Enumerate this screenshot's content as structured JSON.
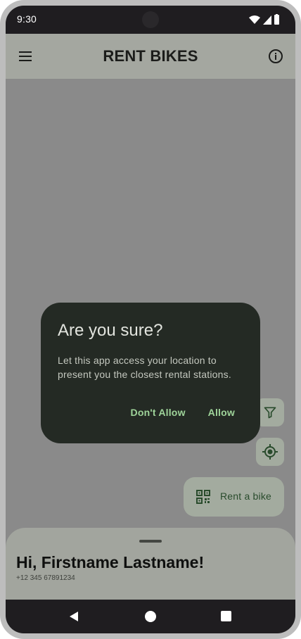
{
  "status_bar": {
    "time": "9:30",
    "icons": [
      "wifi-icon",
      "cellular-signal-icon",
      "battery-icon"
    ]
  },
  "app_bar": {
    "title": "RENT BIKES",
    "left_icon": "menu-icon",
    "right_icon": "info-icon"
  },
  "dialog": {
    "title": "Are you sure?",
    "body": "Let this app access your location to present you the closest rental stations.",
    "deny_label": "Don't Allow",
    "allow_label": "Allow"
  },
  "fabs": {
    "filter_icon": "filter-icon",
    "locate_icon": "my-location-icon",
    "rent_label": "Rent a bike",
    "rent_icon": "qr-code-icon"
  },
  "bottom_sheet": {
    "greeting": "Hi, Firstname Lastname!",
    "phone": "+12 345 67891234"
  },
  "nav_bar": {
    "icons": [
      "back-icon",
      "home-icon",
      "recents-icon"
    ]
  },
  "colors": {
    "scrim": "#8a8a8a",
    "app_bar": "#a4a7a0",
    "dialog_surface": "#242a24",
    "dialog_action": "#9fd49a",
    "fab": "#a3ab9f",
    "system_bars": "#1f1d20"
  }
}
